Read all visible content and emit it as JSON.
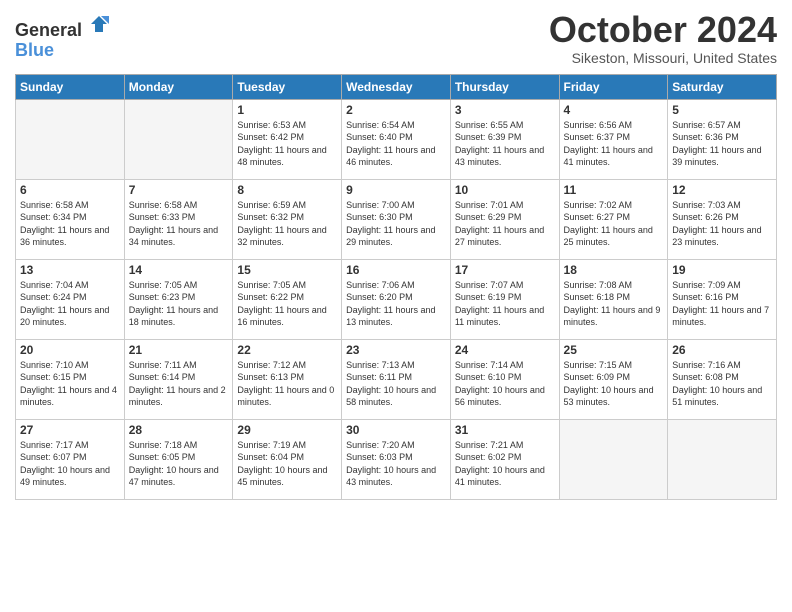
{
  "logo": {
    "general": "General",
    "blue": "Blue"
  },
  "title": "October 2024",
  "subtitle": "Sikeston, Missouri, United States",
  "weekdays": [
    "Sunday",
    "Monday",
    "Tuesday",
    "Wednesday",
    "Thursday",
    "Friday",
    "Saturday"
  ],
  "weeks": [
    [
      {
        "day": "",
        "info": ""
      },
      {
        "day": "",
        "info": ""
      },
      {
        "day": "1",
        "info": "Sunrise: 6:53 AM\nSunset: 6:42 PM\nDaylight: 11 hours and 48 minutes."
      },
      {
        "day": "2",
        "info": "Sunrise: 6:54 AM\nSunset: 6:40 PM\nDaylight: 11 hours and 46 minutes."
      },
      {
        "day": "3",
        "info": "Sunrise: 6:55 AM\nSunset: 6:39 PM\nDaylight: 11 hours and 43 minutes."
      },
      {
        "day": "4",
        "info": "Sunrise: 6:56 AM\nSunset: 6:37 PM\nDaylight: 11 hours and 41 minutes."
      },
      {
        "day": "5",
        "info": "Sunrise: 6:57 AM\nSunset: 6:36 PM\nDaylight: 11 hours and 39 minutes."
      }
    ],
    [
      {
        "day": "6",
        "info": "Sunrise: 6:58 AM\nSunset: 6:34 PM\nDaylight: 11 hours and 36 minutes."
      },
      {
        "day": "7",
        "info": "Sunrise: 6:58 AM\nSunset: 6:33 PM\nDaylight: 11 hours and 34 minutes."
      },
      {
        "day": "8",
        "info": "Sunrise: 6:59 AM\nSunset: 6:32 PM\nDaylight: 11 hours and 32 minutes."
      },
      {
        "day": "9",
        "info": "Sunrise: 7:00 AM\nSunset: 6:30 PM\nDaylight: 11 hours and 29 minutes."
      },
      {
        "day": "10",
        "info": "Sunrise: 7:01 AM\nSunset: 6:29 PM\nDaylight: 11 hours and 27 minutes."
      },
      {
        "day": "11",
        "info": "Sunrise: 7:02 AM\nSunset: 6:27 PM\nDaylight: 11 hours and 25 minutes."
      },
      {
        "day": "12",
        "info": "Sunrise: 7:03 AM\nSunset: 6:26 PM\nDaylight: 11 hours and 23 minutes."
      }
    ],
    [
      {
        "day": "13",
        "info": "Sunrise: 7:04 AM\nSunset: 6:24 PM\nDaylight: 11 hours and 20 minutes."
      },
      {
        "day": "14",
        "info": "Sunrise: 7:05 AM\nSunset: 6:23 PM\nDaylight: 11 hours and 18 minutes."
      },
      {
        "day": "15",
        "info": "Sunrise: 7:05 AM\nSunset: 6:22 PM\nDaylight: 11 hours and 16 minutes."
      },
      {
        "day": "16",
        "info": "Sunrise: 7:06 AM\nSunset: 6:20 PM\nDaylight: 11 hours and 13 minutes."
      },
      {
        "day": "17",
        "info": "Sunrise: 7:07 AM\nSunset: 6:19 PM\nDaylight: 11 hours and 11 minutes."
      },
      {
        "day": "18",
        "info": "Sunrise: 7:08 AM\nSunset: 6:18 PM\nDaylight: 11 hours and 9 minutes."
      },
      {
        "day": "19",
        "info": "Sunrise: 7:09 AM\nSunset: 6:16 PM\nDaylight: 11 hours and 7 minutes."
      }
    ],
    [
      {
        "day": "20",
        "info": "Sunrise: 7:10 AM\nSunset: 6:15 PM\nDaylight: 11 hours and 4 minutes."
      },
      {
        "day": "21",
        "info": "Sunrise: 7:11 AM\nSunset: 6:14 PM\nDaylight: 11 hours and 2 minutes."
      },
      {
        "day": "22",
        "info": "Sunrise: 7:12 AM\nSunset: 6:13 PM\nDaylight: 11 hours and 0 minutes."
      },
      {
        "day": "23",
        "info": "Sunrise: 7:13 AM\nSunset: 6:11 PM\nDaylight: 10 hours and 58 minutes."
      },
      {
        "day": "24",
        "info": "Sunrise: 7:14 AM\nSunset: 6:10 PM\nDaylight: 10 hours and 56 minutes."
      },
      {
        "day": "25",
        "info": "Sunrise: 7:15 AM\nSunset: 6:09 PM\nDaylight: 10 hours and 53 minutes."
      },
      {
        "day": "26",
        "info": "Sunrise: 7:16 AM\nSunset: 6:08 PM\nDaylight: 10 hours and 51 minutes."
      }
    ],
    [
      {
        "day": "27",
        "info": "Sunrise: 7:17 AM\nSunset: 6:07 PM\nDaylight: 10 hours and 49 minutes."
      },
      {
        "day": "28",
        "info": "Sunrise: 7:18 AM\nSunset: 6:05 PM\nDaylight: 10 hours and 47 minutes."
      },
      {
        "day": "29",
        "info": "Sunrise: 7:19 AM\nSunset: 6:04 PM\nDaylight: 10 hours and 45 minutes."
      },
      {
        "day": "30",
        "info": "Sunrise: 7:20 AM\nSunset: 6:03 PM\nDaylight: 10 hours and 43 minutes."
      },
      {
        "day": "31",
        "info": "Sunrise: 7:21 AM\nSunset: 6:02 PM\nDaylight: 10 hours and 41 minutes."
      },
      {
        "day": "",
        "info": ""
      },
      {
        "day": "",
        "info": ""
      }
    ]
  ]
}
